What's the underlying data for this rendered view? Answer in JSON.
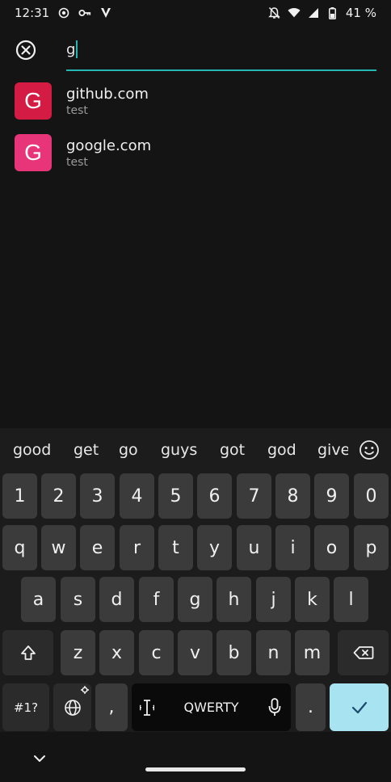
{
  "status": {
    "time": "12:31",
    "battery": "41 %"
  },
  "search": {
    "value": "g"
  },
  "results": [
    {
      "letter": "G",
      "title": "github.com",
      "subtitle": "test",
      "color": "#d31b44"
    },
    {
      "letter": "G",
      "title": "google.com",
      "subtitle": "test",
      "color": "#e8357a"
    }
  ],
  "keyboard": {
    "suggestions": [
      "good",
      "get",
      "go",
      "guys",
      "got",
      "god",
      "give"
    ],
    "row_numbers": [
      "1",
      "2",
      "3",
      "4",
      "5",
      "6",
      "7",
      "8",
      "9",
      "0"
    ],
    "row_top": [
      "q",
      "w",
      "e",
      "r",
      "t",
      "y",
      "u",
      "i",
      "o",
      "p"
    ],
    "row_mid": [
      "a",
      "s",
      "d",
      "f",
      "g",
      "h",
      "j",
      "k",
      "l"
    ],
    "row_bottom": [
      "z",
      "x",
      "c",
      "v",
      "b",
      "n",
      "m"
    ],
    "symbols_label": "#1?",
    "comma_label": ",",
    "space_label": "QWERTY",
    "period_label": "."
  },
  "colors": {
    "accent": "#25b5b2",
    "confirm_key": "#a8e3f1",
    "background": "#141414"
  }
}
